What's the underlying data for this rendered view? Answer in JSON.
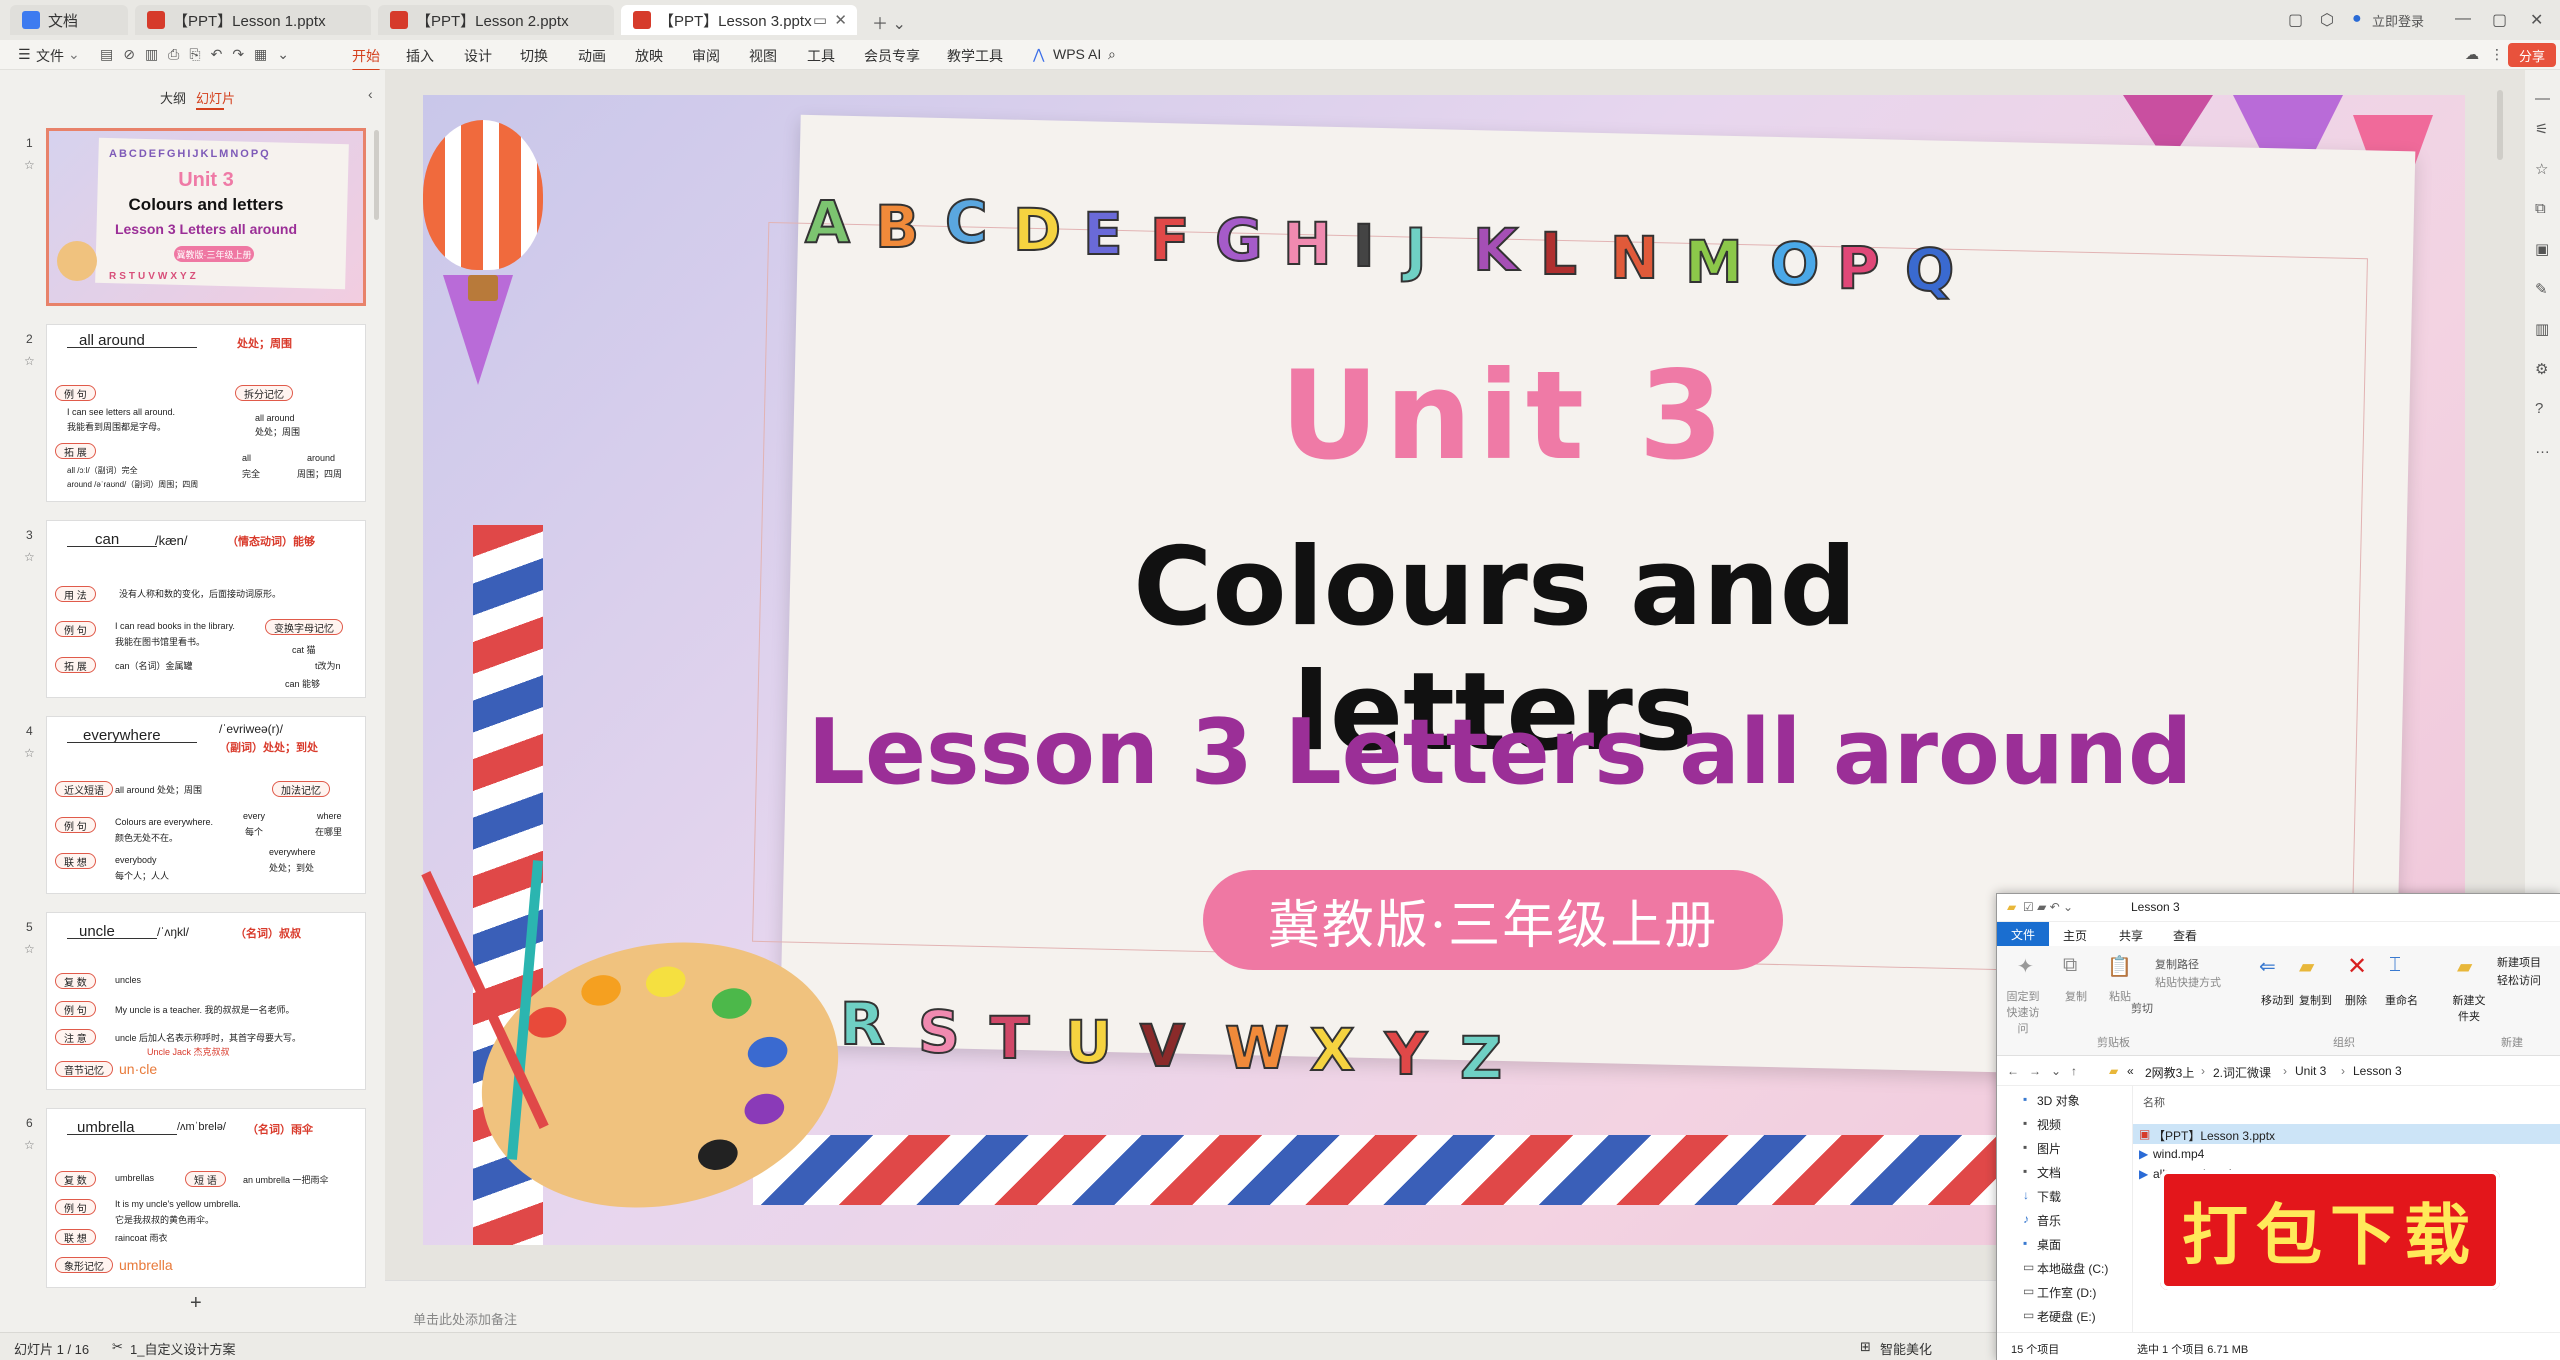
{
  "tabs": [
    {
      "label": "文档"
    },
    {
      "label": "【PPT】Lesson 1.pptx"
    },
    {
      "label": "【PPT】Lesson 2.pptx"
    },
    {
      "label": "【PPT】Lesson 3.pptx"
    }
  ],
  "window": {
    "login": "立即登录",
    "share": "分享"
  },
  "ribbon": {
    "file": "文件",
    "items": [
      "开始",
      "插入",
      "设计",
      "切换",
      "动画",
      "放映",
      "审阅",
      "视图",
      "工具",
      "会员专享",
      "教学工具"
    ],
    "wps_ai": "WPS AI"
  },
  "left_panel": {
    "tab_outline": "大纲",
    "tab_slides": "幻灯片",
    "add": "+"
  },
  "thumbs": [
    {
      "num": "1",
      "title": "Unit 3",
      "subtitle": "Colours and letters",
      "lesson": "Lesson 3 Letters all around",
      "tag": "冀教版·三年级上册"
    },
    {
      "num": "2",
      "word": "all around",
      "meaning": "处处；周围",
      "l1": "例 句",
      "l2": "拓 展",
      "pill": "拆分记忆",
      "s1": "I can see letters all around.",
      "s2": "我能看到周围都是字母。",
      "s3": "all around",
      "s4": "处处；周围",
      "s5": "all  /ɔːl/（副词）完全",
      "s6": "around /əˈraʊnd/（副词）周围；四周",
      "s7": "all",
      "s8": "完全",
      "s9": "around",
      "s10": "周围；四周"
    },
    {
      "num": "3",
      "word": "can",
      "phon": "/kæn/",
      "meaning": "（情态动词）能够",
      "l1": "用 法",
      "l2": "例 句",
      "l3": "拓 展",
      "pill": "变换字母记忆",
      "s1": "没有人称和数的变化，后面接动词原形。",
      "s2": "I can read books in the library.",
      "s3": "我能在图书馆里看书。",
      "s4": "can（名词）金属罐",
      "s5": "cat 猫",
      "s6": "t改为n",
      "s7": "can 能够"
    },
    {
      "num": "4",
      "word": "everywhere",
      "phon": "/ˈevriweə(r)/",
      "meaning": "（副词）处处；到处",
      "l1": "近义短语",
      "l2": "例 句",
      "l3": "联 想",
      "pill": "加法记忆",
      "s1": "all around 处处；周围",
      "s2": "Colours are everywhere.",
      "s3": "颜色无处不在。",
      "s4": "everybody",
      "s5": "每个人；人人",
      "s6": "every",
      "s7": "每个",
      "s8": "where",
      "s9": "在哪里",
      "s10": "everywhere",
      "s11": "处处；到处"
    },
    {
      "num": "5",
      "word": "uncle",
      "phon": "/ˈʌŋkl/",
      "meaning": "（名词）叔叔",
      "l1": "复 数",
      "l2": "例 句",
      "l3": "注 意",
      "l4": "音节记忆",
      "s1": "uncles",
      "s2": "My uncle is a teacher. 我的叔叔是一名老师。",
      "s3": "uncle 后加人名表示称呼时，其首字母要大写。",
      "s4": "Uncle Jack 杰克叔叔",
      "s5": "un·cle"
    },
    {
      "num": "6",
      "word": "umbrella",
      "phon": "/ʌmˈbrelə/",
      "meaning": "（名词）雨伞",
      "l1": "复 数",
      "l2": "例 句",
      "l3": "联 想",
      "l4": "象形记忆",
      "pill": "短 语",
      "s1": "umbrellas",
      "s2": "an umbrella 一把雨伞",
      "s3": "It is my uncle's yellow umbrella.",
      "s4": "它是我叔叔的黄色雨伞。",
      "s5": "raincoat 雨衣",
      "s6": "umbrella"
    }
  ],
  "slide": {
    "unit": "Unit 3",
    "title": "Colours and letters",
    "lesson": "Lesson 3 Letters all around",
    "badge": "冀教版·三年级上册",
    "letters_top": [
      "A",
      "B",
      "C",
      "D",
      "E",
      "F",
      "G",
      "H",
      "I",
      "J",
      "K",
      "L",
      "N",
      "M",
      "O",
      "P",
      "Q"
    ],
    "letters_bottom": [
      "R",
      "S",
      "T",
      "U",
      "V",
      "W",
      "X",
      "Y",
      "Z"
    ]
  },
  "notes": {
    "placeholder": "单击此处添加备注"
  },
  "status": {
    "slide_info": "幻灯片 1 / 16",
    "theme": "1_自定义设计方案",
    "beautify": "智能美化"
  },
  "explorer": {
    "title": "Lesson 3",
    "tabs": [
      "文件",
      "主页",
      "共享",
      "查看"
    ],
    "ribbon": [
      "固定到快速访问",
      "复制",
      "粘贴",
      "复制路径",
      "粘贴快捷方式",
      "剪切",
      "剪贴板",
      "移动到",
      "复制到",
      "删除",
      "重命名",
      "组织",
      "新建文件夹",
      "新建项目",
      "轻松访问",
      "新建"
    ],
    "path": [
      "«",
      "2网教3上",
      "2.词汇微课",
      "Unit 3",
      "Lesson 3"
    ],
    "nav": [
      "3D 对象",
      "视频",
      "图片",
      "文档",
      "下载",
      "音乐",
      "桌面",
      "本地磁盘 (C:)",
      "工作室 (D:)",
      "老硬盘 (E:)"
    ],
    "column": "名称",
    "files": [
      "【PPT】Lesson 3.pptx",
      "wind.mp4",
      "all around.mp4"
    ],
    "status_items": "15 个项目",
    "status_sel": "选中 1 个项目  6.71 MB"
  },
  "download_badge": "打包下载",
  "colors": {
    "accent": "#d4401d",
    "pink": "#ef78a3",
    "purple": "#9b2f97"
  }
}
